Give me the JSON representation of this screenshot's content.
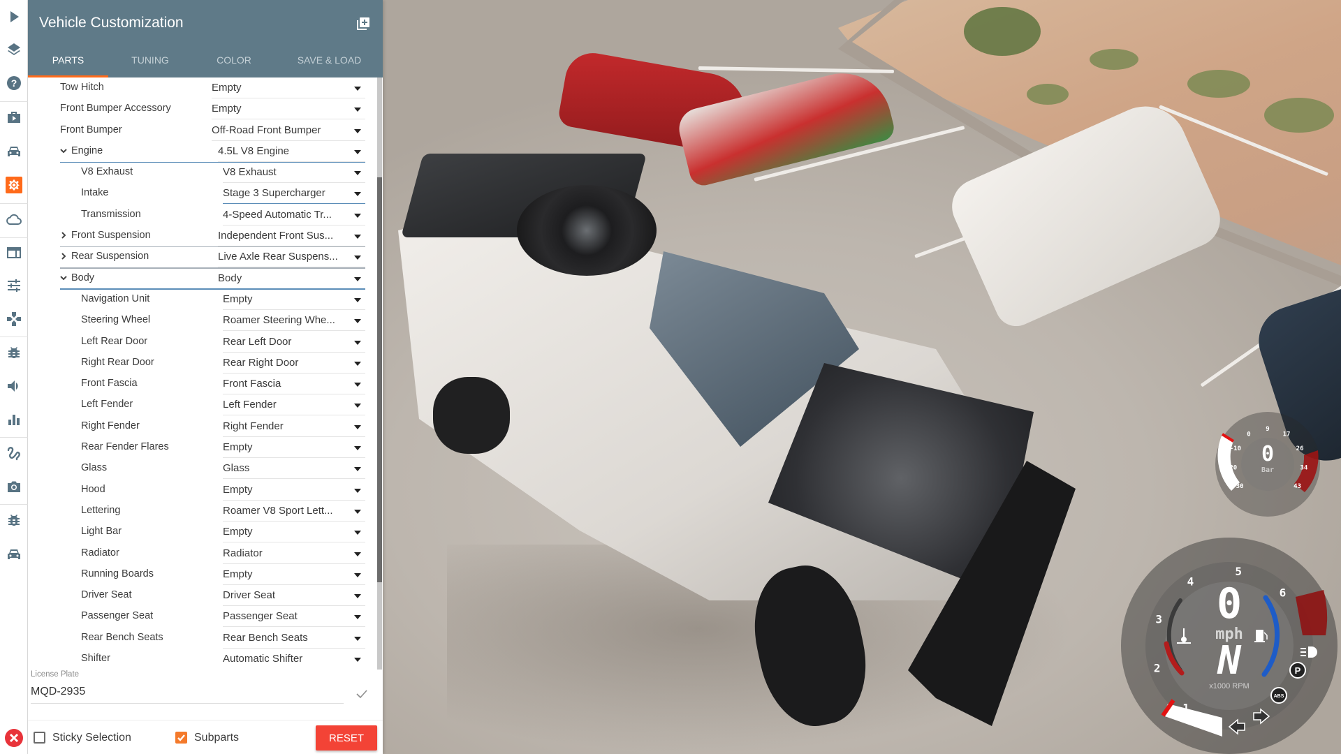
{
  "panel": {
    "title": "Vehicle Customization",
    "add_icon": "library-add-icon",
    "tabs": [
      {
        "label": "PARTS",
        "active": true
      },
      {
        "label": "TUNING",
        "active": false
      },
      {
        "label": "COLOR",
        "active": false
      },
      {
        "label": "SAVE & LOAD",
        "active": false
      }
    ]
  },
  "sidebar": {
    "items": [
      {
        "icon": "play-icon"
      },
      {
        "icon": "layers-icon"
      },
      {
        "icon": "help-icon"
      },
      {
        "icon": "scenario-briefcase-icon"
      },
      {
        "icon": "car-icon"
      },
      {
        "icon": "settings-gear-icon",
        "active": true
      },
      {
        "icon": "cloud-icon"
      },
      {
        "icon": "layout-icon"
      },
      {
        "icon": "tune-sliders-icon"
      },
      {
        "icon": "gamepad-icon"
      },
      {
        "icon": "bug-icon"
      },
      {
        "icon": "volume-icon"
      },
      {
        "icon": "bar-chart-icon"
      },
      {
        "icon": "route-icon"
      },
      {
        "icon": "camera-icon"
      },
      {
        "icon": "bug-icon"
      },
      {
        "icon": "car-icon"
      }
    ],
    "close_icon": "close-icon",
    "accent_color": "#ff6a1a"
  },
  "parts": [
    {
      "label": "Tow Hitch",
      "value": "Empty",
      "level": 0
    },
    {
      "label": "Front Bumper Accessory",
      "value": "Empty",
      "level": 0
    },
    {
      "label": "Front Bumper",
      "value": "Off-Road Front Bumper",
      "level": 0
    },
    {
      "label": "Engine",
      "value": "4.5L V8 Engine",
      "level": 0,
      "expandable": true,
      "expanded": true
    },
    {
      "label": "V8 Exhaust",
      "value": "V8 Exhaust",
      "level": 1
    },
    {
      "label": "Intake",
      "value": "Stage 3 Supercharger",
      "level": 1,
      "focused": true
    },
    {
      "label": "Transmission",
      "value": "4-Speed Automatic Tr...",
      "level": 1
    },
    {
      "label": "Front Suspension",
      "value": "Independent Front Sus...",
      "level": 0,
      "expandable": true,
      "expanded": false
    },
    {
      "label": "Rear Suspension",
      "value": "Live Axle Rear Suspens...",
      "level": 0,
      "expandable": true,
      "expanded": false
    },
    {
      "label": "Body",
      "value": "Body",
      "level": 0,
      "expandable": true,
      "expanded": true
    },
    {
      "label": "Navigation Unit",
      "value": "Empty",
      "level": 1
    },
    {
      "label": "Steering Wheel",
      "value": "Roamer Steering Whe...",
      "level": 1
    },
    {
      "label": "Left Rear Door",
      "value": "Rear Left Door",
      "level": 1
    },
    {
      "label": "Right Rear Door",
      "value": "Rear Right Door",
      "level": 1
    },
    {
      "label": "Front Fascia",
      "value": "Front Fascia",
      "level": 1
    },
    {
      "label": "Left Fender",
      "value": "Left Fender",
      "level": 1
    },
    {
      "label": "Right Fender",
      "value": "Right Fender",
      "level": 1
    },
    {
      "label": "Rear Fender Flares",
      "value": "Empty",
      "level": 1
    },
    {
      "label": "Glass",
      "value": "Glass",
      "level": 1
    },
    {
      "label": "Hood",
      "value": "Empty",
      "level": 1
    },
    {
      "label": "Lettering",
      "value": "Roamer V8 Sport Lett...",
      "level": 1
    },
    {
      "label": "Light Bar",
      "value": "Empty",
      "level": 1
    },
    {
      "label": "Radiator",
      "value": "Radiator",
      "level": 1
    },
    {
      "label": "Running Boards",
      "value": "Empty",
      "level": 1
    },
    {
      "label": "Driver Seat",
      "value": "Driver Seat",
      "level": 1
    },
    {
      "label": "Passenger Seat",
      "value": "Passenger Seat",
      "level": 1
    },
    {
      "label": "Rear Bench Seats",
      "value": "Rear Bench Seats",
      "level": 1
    },
    {
      "label": "Shifter",
      "value": "Automatic Shifter",
      "level": 1
    }
  ],
  "license_plate": {
    "label": "License Plate",
    "value": "MQD-2935",
    "confirm_icon": "check-icon"
  },
  "footer": {
    "sticky_selection": {
      "label": "Sticky Selection",
      "checked": false
    },
    "subparts": {
      "label": "Subparts",
      "checked": true
    },
    "reset_label": "RESET",
    "reset_color": "#f34336"
  },
  "hud": {
    "boost_gauge": {
      "value": "0",
      "unit": "Bar",
      "ticks": [
        "-30",
        "-20",
        "-10",
        "0",
        "9",
        "17",
        "26",
        "34",
        "43"
      ]
    },
    "speedometer": {
      "speed": "0",
      "speed_unit": "mph",
      "gear": "N",
      "rpm_label": "x1000 RPM",
      "rpm_ticks": [
        "1",
        "2",
        "3",
        "4",
        "5",
        "6"
      ],
      "indicators": [
        "headlight-icon",
        "parking-brake-icon",
        "abs-icon",
        "turn-signal-left-icon",
        "turn-signal-right-icon",
        "temperature-icon",
        "fuel-icon"
      ],
      "parking_label": "P",
      "abs_label": "ABS"
    }
  }
}
